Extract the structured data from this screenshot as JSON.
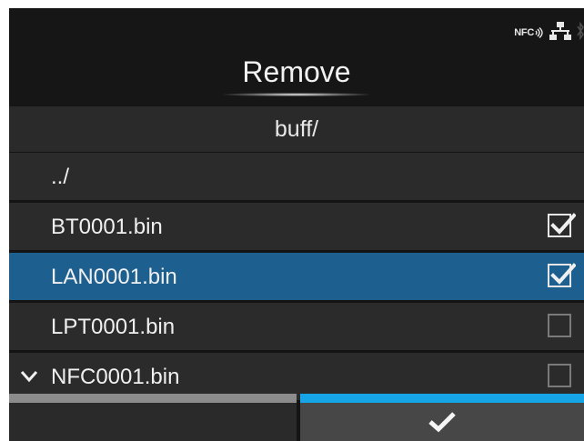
{
  "status_bar": {
    "nfc_label": "NFC",
    "icons": [
      "nfc-icon",
      "network-lan-icon",
      "bluetooth-icon"
    ]
  },
  "header": {
    "title": "Remove"
  },
  "path": "buff/",
  "files": [
    {
      "name": "../",
      "checked": null,
      "selected": false,
      "chevron": false
    },
    {
      "name": "BT0001.bin",
      "checked": true,
      "selected": false,
      "chevron": false
    },
    {
      "name": "LAN0001.bin",
      "checked": true,
      "selected": true,
      "chevron": false
    },
    {
      "name": "LPT0001.bin",
      "checked": false,
      "selected": false,
      "chevron": false
    },
    {
      "name": "NFC0001.bin",
      "checked": false,
      "selected": false,
      "chevron": true
    }
  ],
  "footer": {
    "left_button_icon": "",
    "right_button_icon": "checkmark-icon"
  },
  "colors": {
    "background": "#141414",
    "row": "#2b2b2b",
    "selected_row": "#1d5f8e",
    "accent_tab": "#16a6e8",
    "inactive_tab": "#8c8c8c"
  }
}
